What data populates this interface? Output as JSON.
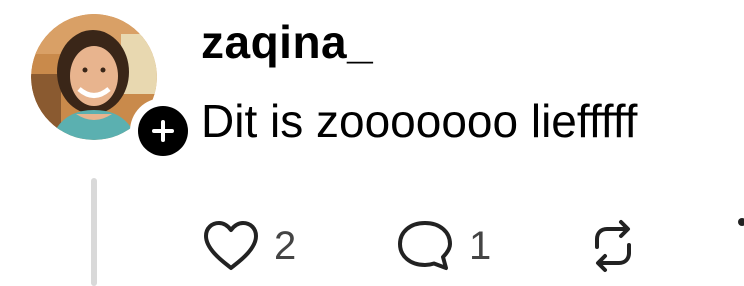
{
  "post": {
    "username": "zaqina_",
    "text": "Dit is zooooooo liefffff",
    "avatar": {
      "description_icon": "user-avatar"
    },
    "follow_icon": "plus-icon"
  },
  "actions": {
    "like": {
      "icon": "heart-icon",
      "count": "2"
    },
    "comment": {
      "icon": "comment-bubble-icon",
      "count": "1"
    },
    "repost": {
      "icon": "repost-icon"
    },
    "share": {
      "icon": "share-icon"
    }
  },
  "colors": {
    "text": "#000000",
    "count": "#444444",
    "thread_line": "#d9d9d9",
    "badge": "#000000"
  }
}
